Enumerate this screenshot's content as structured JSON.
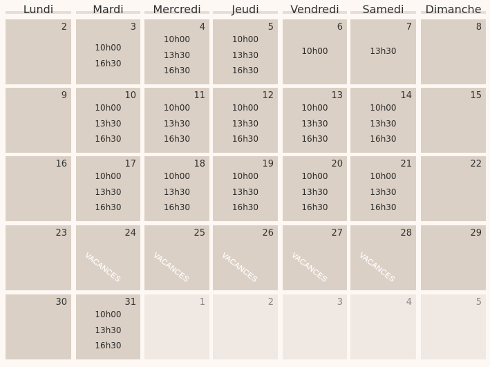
{
  "weekdays": [
    "Lundi",
    "Mardi",
    "Mercredi",
    "Jeudi",
    "Vendredi",
    "Samedi",
    "Dimanche"
  ],
  "weeks": [
    [
      {
        "day": "2",
        "times": []
      },
      {
        "day": "3",
        "times": [
          "10h00",
          "16h30"
        ]
      },
      {
        "day": "4",
        "times": [
          "10h00",
          "13h30",
          "16h30"
        ]
      },
      {
        "day": "5",
        "times": [
          "10h00",
          "13h30",
          "16h30"
        ]
      },
      {
        "day": "6",
        "times": [
          "10h00"
        ]
      },
      {
        "day": "7",
        "times": [
          "13h30"
        ]
      },
      {
        "day": "8",
        "times": []
      }
    ],
    [
      {
        "day": "9",
        "times": []
      },
      {
        "day": "10",
        "times": [
          "10h00",
          "13h30",
          "16h30"
        ]
      },
      {
        "day": "11",
        "times": [
          "10h00",
          "13h30",
          "16h30"
        ]
      },
      {
        "day": "12",
        "times": [
          "10h00",
          "13h30",
          "16h30"
        ]
      },
      {
        "day": "13",
        "times": [
          "10h00",
          "13h30",
          "16h30"
        ]
      },
      {
        "day": "14",
        "times": [
          "10h00",
          "13h30",
          "16h30"
        ]
      },
      {
        "day": "15",
        "times": []
      }
    ],
    [
      {
        "day": "16",
        "times": []
      },
      {
        "day": "17",
        "times": [
          "10h00",
          "13h30",
          "16h30"
        ]
      },
      {
        "day": "18",
        "times": [
          "10h00",
          "13h30",
          "16h30"
        ]
      },
      {
        "day": "19",
        "times": [
          "10h00",
          "13h30",
          "16h30"
        ]
      },
      {
        "day": "20",
        "times": [
          "10h00",
          "13h30",
          "16h30"
        ]
      },
      {
        "day": "21",
        "times": [
          "10h00",
          "13h30",
          "16h30"
        ]
      },
      {
        "day": "22",
        "times": []
      }
    ],
    [
      {
        "day": "23",
        "times": []
      },
      {
        "day": "24",
        "times": [],
        "label": "VACANCES"
      },
      {
        "day": "25",
        "times": [],
        "label": "VACANCES"
      },
      {
        "day": "26",
        "times": [],
        "label": "VACANCES"
      },
      {
        "day": "27",
        "times": [],
        "label": "VACANCES"
      },
      {
        "day": "28",
        "times": [],
        "label": "VACANCES"
      },
      {
        "day": "29",
        "times": []
      }
    ],
    [
      {
        "day": "30",
        "times": []
      },
      {
        "day": "31",
        "times": [
          "10h00",
          "13h30",
          "16h30"
        ]
      },
      {
        "day": "1",
        "times": [],
        "other_month": true
      },
      {
        "day": "2",
        "times": [],
        "other_month": true
      },
      {
        "day": "3",
        "times": [],
        "other_month": true
      },
      {
        "day": "4",
        "times": [],
        "other_month": true
      },
      {
        "day": "5",
        "times": [],
        "other_month": true
      }
    ]
  ]
}
